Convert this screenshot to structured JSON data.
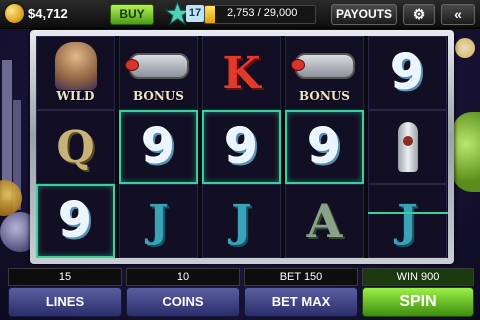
{
  "topbar": {
    "balance": "$4,712",
    "buy_label": "BUY",
    "level": "17",
    "xp_text": "2,753 / 29,000",
    "xp_progress": 0.0949,
    "payouts_label": "PAYOUTS",
    "settings_icon": "gear-icon",
    "back_icon": "double-chevron-left-icon"
  },
  "reels": [
    [
      {
        "symbol": "hero",
        "label": "WILD"
      },
      {
        "symbol": "Q",
        "label": ""
      },
      {
        "symbol": "9",
        "label": ""
      }
    ],
    [
      {
        "symbol": "ray-gun",
        "label": "BONUS"
      },
      {
        "symbol": "9",
        "label": ""
      },
      {
        "symbol": "J",
        "label": ""
      }
    ],
    [
      {
        "symbol": "K",
        "label": ""
      },
      {
        "symbol": "9",
        "label": ""
      },
      {
        "symbol": "J",
        "label": ""
      }
    ],
    [
      {
        "symbol": "ray-gun",
        "label": "BONUS"
      },
      {
        "symbol": "9",
        "label": ""
      },
      {
        "symbol": "A",
        "label": ""
      }
    ],
    [
      {
        "symbol": "9",
        "label": ""
      },
      {
        "symbol": "rocket",
        "label": ""
      },
      {
        "symbol": "J",
        "label": ""
      }
    ]
  ],
  "controls": {
    "lines_value": "15",
    "coins_value": "10",
    "bet_text": "BET 150",
    "win_text": "WIN 900",
    "lines_label": "LINES",
    "coins_label": "COINS",
    "betmax_label": "BET MAX",
    "spin_label": "SPIN"
  },
  "colors": {
    "accent": "#38d19a",
    "spin_green": "#4c9b14",
    "button_blue": "#3a3f86"
  }
}
